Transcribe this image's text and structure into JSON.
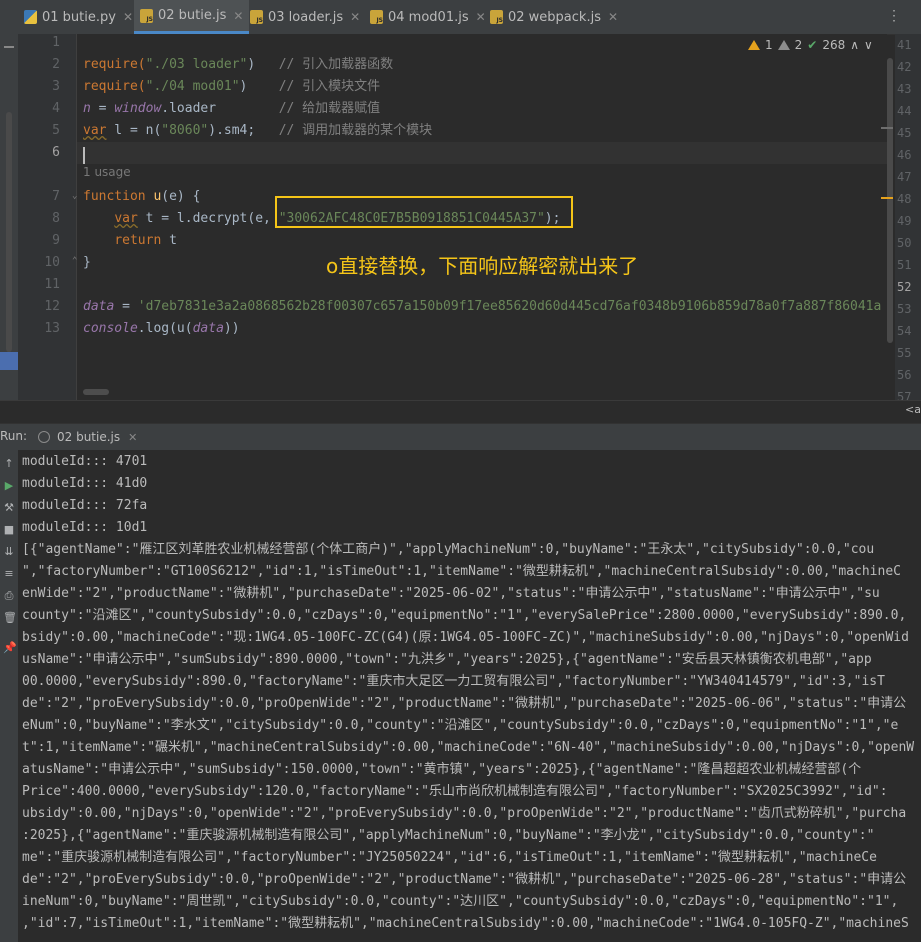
{
  "tabs": [
    {
      "label": "01 butie.py",
      "icon": "python-file-icon",
      "active": false
    },
    {
      "label": "02 butie.js",
      "icon": "js-file-icon",
      "active": true
    },
    {
      "label": "03 loader.js",
      "icon": "js-file-icon",
      "active": false
    },
    {
      "label": "04 mod01.js",
      "icon": "js-file-icon",
      "active": false
    },
    {
      "label": "02 webpack.js",
      "icon": "js-file-icon",
      "active": false
    }
  ],
  "inspection": {
    "warnings": "1",
    "weak_warnings": "2",
    "typos": "268",
    "up": "∧",
    "down": "∨"
  },
  "editor": {
    "line_numbers": [
      "1",
      "2",
      "3",
      "4",
      "5",
      "6",
      "7",
      "8",
      "9",
      "10",
      "11",
      "12",
      "13"
    ],
    "right_line_numbers": [
      "41",
      "42",
      "43",
      "44",
      "45",
      "46",
      "47",
      "48",
      "49",
      "50",
      "51",
      "52",
      "53",
      "54",
      "55",
      "56",
      "57"
    ],
    "code": {
      "l2_a": "require(",
      "l2_b": "\"./03 loader\"",
      "l2_c": ")   ",
      "l2_d": "// 引入加载器函数",
      "l3_a": "require(",
      "l3_b": "\"./04 mod01\"",
      "l3_c": ")    ",
      "l3_d": "// 引入模块文件",
      "l4_a": "n",
      "l4_b": " = ",
      "l4_c": "window",
      "l4_d": ".loader        ",
      "l4_e": "// 给加载器赋值",
      "l5_a": "var",
      "l5_b": " l = n(",
      "l5_c": "\"8060\"",
      "l5_d": ").sm4;   ",
      "l5_e": "// 调用加载器的某个模块",
      "usage": "1 usage",
      "l7_a": "function",
      "l7_b": " ",
      "l7_c": "u",
      "l7_d": "(e) {",
      "l8_a": "    ",
      "l8_b": "var",
      "l8_c": " t = l.decrypt(e, ",
      "l8_d": "\"30062AFC48C0E7B5B0918851C0445A37\"",
      "l8_e": ");",
      "l9_a": "    ",
      "l9_b": "return",
      "l9_c": " t",
      "l10": "}",
      "l12_a": "data",
      "l12_b": " = ",
      "l12_c": "'d7eb7831e3a2a0868562b28f00307c657a150b09f17ee85620d60d445cd76af0348b9106b859d78a0f7a887f86041a",
      "l13_a": "console",
      "l13_b": ".log(u(",
      "l13_c": "data",
      "l13_d": "))"
    },
    "annotation": "o直接替换，下面响应解密就出来了",
    "breadcrumb": "<a"
  },
  "run": {
    "label": "Run:",
    "tab": "02 butie.js",
    "output": [
      "moduleId::: 4701",
      "moduleId::: 41d0",
      "moduleId::: 72fa",
      "moduleId::: 10d1",
      "[{\"agentName\":\"雁江区刘革胜农业机械经营部(个体工商户)\",\"applyMachineNum\":0,\"buyName\":\"王永太\",\"citySubsidy\":0.0,\"cou",
      "\",\"factoryNumber\":\"GT100S6212\",\"id\":1,\"isTimeOut\":1,\"itemName\":\"微型耕耘机\",\"machineCentralSubsidy\":0.00,\"machineC",
      "enWide\":\"2\",\"productName\":\"微耕机\",\"purchaseDate\":\"2025-06-02\",\"status\":\"申请公示中\",\"statusName\":\"申请公示中\",\"su",
      "county\":\"沿滩区\",\"countySubsidy\":0.0,\"czDays\":0,\"equipmentNo\":\"1\",\"everySalePrice\":2800.0000,\"everySubsidy\":890.0,",
      "bsidy\":0.00,\"machineCode\":\"现:1WG4.05-100FC-ZC(G4)(原:1WG4.05-100FC-ZC)\",\"machineSubsidy\":0.00,\"njDays\":0,\"openWid",
      "usName\":\"申请公示中\",\"sumSubsidy\":890.0000,\"town\":\"九洪乡\",\"years\":2025},{\"agentName\":\"安岳县天林镇衡农机电部\",\"app",
      "00.0000,\"everySubsidy\":890.0,\"factoryName\":\"重庆市大足区一力工贸有限公司\",\"factoryNumber\":\"YW340414579\",\"id\":3,\"isT",
      "de\":\"2\",\"proEverySubsidy\":0.0,\"proOpenWide\":\"2\",\"productName\":\"微耕机\",\"purchaseDate\":\"2025-06-06\",\"status\":\"申请公",
      "eNum\":0,\"buyName\":\"李水文\",\"citySubsidy\":0.0,\"county\":\"沿滩区\",\"countySubsidy\":0.0,\"czDays\":0,\"equipmentNo\":\"1\",\"e",
      "t\":1,\"itemName\":\"碾米机\",\"machineCentralSubsidy\":0.00,\"machineCode\":\"6N-40\",\"machineSubsidy\":0.00,\"njDays\":0,\"openW",
      "atusName\":\"申请公示中\",\"sumSubsidy\":150.0000,\"town\":\"黄市镇\",\"years\":2025},{\"agentName\":\"隆昌超超农业机械经营部(个",
      "Price\":400.0000,\"everySubsidy\":120.0,\"factoryName\":\"乐山市尚欣机械制造有限公司\",\"factoryNumber\":\"SX2025C3992\",\"id\":",
      "ubsidy\":0.00,\"njDays\":0,\"openWide\":\"2\",\"proEverySubsidy\":0.0,\"proOpenWide\":\"2\",\"productName\":\"齿爪式粉碎机\",\"purcha",
      ":2025},{\"agentName\":\"重庆骏源机械制造有限公司\",\"applyMachineNum\":0,\"buyName\":\"李小龙\",\"citySubsidy\":0.0,\"county\":\"",
      "me\":\"重庆骏源机械制造有限公司\",\"factoryNumber\":\"JY25050224\",\"id\":6,\"isTimeOut\":1,\"itemName\":\"微型耕耘机\",\"machineCe",
      "de\":\"2\",\"proEverySubsidy\":0.0,\"proOpenWide\":\"2\",\"productName\":\"微耕机\",\"purchaseDate\":\"2025-06-28\",\"status\":\"申请公",
      "ineNum\":0,\"buyName\":\"周世凯\",\"citySubsidy\":0.0,\"county\":\"达川区\",\"countySubsidy\":0.0,\"czDays\":0,\"equipmentNo\":\"1\",",
      ",\"id\":7,\"isTimeOut\":1,\"itemName\":\"微型耕耘机\",\"machineCentralSubsidy\":0.00,\"machineCode\":\"1WG4.0-105FQ-Z\",\"machineS"
    ]
  }
}
